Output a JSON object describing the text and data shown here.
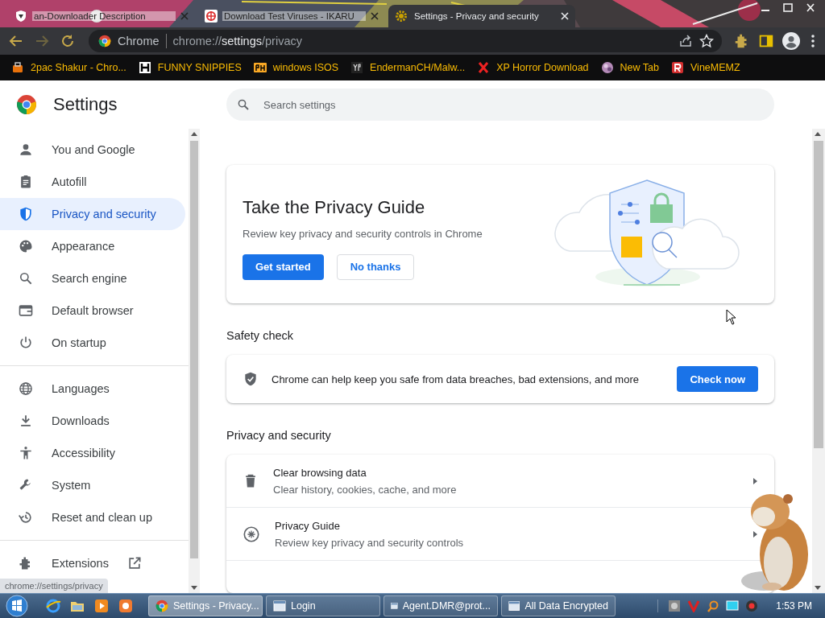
{
  "browser": {
    "tabs": [
      {
        "title": "an-Downloader Description",
        "selected": false
      },
      {
        "title": "Download Test Viruses - IKARU",
        "selected": false
      },
      {
        "title": "Settings - Privacy and security",
        "selected": true
      }
    ],
    "omnibox": {
      "site_label": "Chrome",
      "url_scheme": "chrome://",
      "url_host": "settings",
      "url_path": "/privacy"
    },
    "bookmarks": [
      {
        "label": "2pac Shakur - Chro..."
      },
      {
        "label": "FUNNY SNIPPIES"
      },
      {
        "label": "windows ISOS"
      },
      {
        "label": "EndermanCH/Malw..."
      },
      {
        "label": "XP Horror Download"
      },
      {
        "label": "New Tab"
      },
      {
        "label": "VineMEMZ"
      }
    ]
  },
  "settings": {
    "title": "Settings",
    "search": {
      "placeholder": "Search settings"
    },
    "sidebar": {
      "groups": [
        [
          {
            "label": "You and Google",
            "selected": false
          },
          {
            "label": "Autofill",
            "selected": false
          },
          {
            "label": "Privacy and security",
            "selected": true
          },
          {
            "label": "Appearance",
            "selected": false
          },
          {
            "label": "Search engine",
            "selected": false
          },
          {
            "label": "Default browser",
            "selected": false
          },
          {
            "label": "On startup",
            "selected": false
          }
        ],
        [
          {
            "label": "Languages",
            "selected": false
          },
          {
            "label": "Downloads",
            "selected": false
          },
          {
            "label": "Accessibility",
            "selected": false
          },
          {
            "label": "System",
            "selected": false
          },
          {
            "label": "Reset and clean up",
            "selected": false
          }
        ],
        [
          {
            "label": "Extensions",
            "selected": false
          }
        ]
      ]
    },
    "privacy_guide": {
      "title": "Take the Privacy Guide",
      "description": "Review key privacy and security controls in Chrome",
      "primary_button": "Get started",
      "secondary_button": "No thanks"
    },
    "safety_check": {
      "heading": "Safety check",
      "text": "Chrome can help keep you safe from data breaches, bad extensions, and more",
      "button": "Check now"
    },
    "privacy_section": {
      "heading": "Privacy and security",
      "rows": [
        {
          "title": "Clear browsing data",
          "subtitle": "Clear history, cookies, cache, and more"
        },
        {
          "title": "Privacy Guide",
          "subtitle": "Review key privacy and security controls"
        }
      ]
    }
  },
  "status_tooltip": "chrome://settings/privacy",
  "taskbar": {
    "tasks": [
      {
        "label": "Settings - Privacy...",
        "selected": true
      },
      {
        "label": "Login",
        "selected": false
      },
      {
        "label": "Agent.DMR@prot...",
        "selected": false
      },
      {
        "label": "All Data Encrypted",
        "selected": false
      }
    ],
    "clock": "1:53 PM"
  }
}
